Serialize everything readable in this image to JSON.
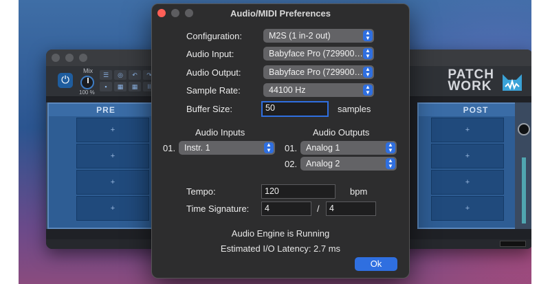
{
  "host": {
    "mix_label": "Mix",
    "mix_value": "100 %",
    "power_icon": "power-icon",
    "logo_line1": "PATCH",
    "logo_line2": "WORK",
    "pre_label": "PRE",
    "post_label": "POST",
    "slot_glyph": "+",
    "slot_count": 4
  },
  "dialog": {
    "title": "Audio/MIDI Preferences",
    "configuration": {
      "label": "Configuration:",
      "value": "M2S (1 in-2 out)"
    },
    "audio_input": {
      "label": "Audio Input:",
      "value": "Babyface Pro (729900…"
    },
    "audio_output": {
      "label": "Audio Output:",
      "value": "Babyface Pro (729900…"
    },
    "sample_rate": {
      "label": "Sample Rate:",
      "value": "44100 Hz"
    },
    "buffer_size": {
      "label": "Buffer Size:",
      "value": "50",
      "unit": "samples"
    },
    "inputs": {
      "header": "Audio Inputs",
      "items": [
        {
          "index": "01.",
          "value": "Instr. 1"
        }
      ]
    },
    "outputs": {
      "header": "Audio Outputs",
      "items": [
        {
          "index": "01.",
          "value": "Analog 1"
        },
        {
          "index": "02.",
          "value": "Analog 2"
        }
      ]
    },
    "tempo": {
      "label": "Tempo:",
      "value": "120",
      "unit": "bpm"
    },
    "time_signature": {
      "label": "Time Signature:",
      "numerator": "4",
      "separator": "/",
      "denominator": "4"
    },
    "engine_status": "Audio Engine is Running",
    "latency": "Estimated I/O Latency: 2.7 ms",
    "ok_label": "Ok"
  },
  "colors": {
    "accent": "#2f6fe0",
    "close_button": "#ff5f57",
    "panel_blue": "#2e5d94"
  }
}
